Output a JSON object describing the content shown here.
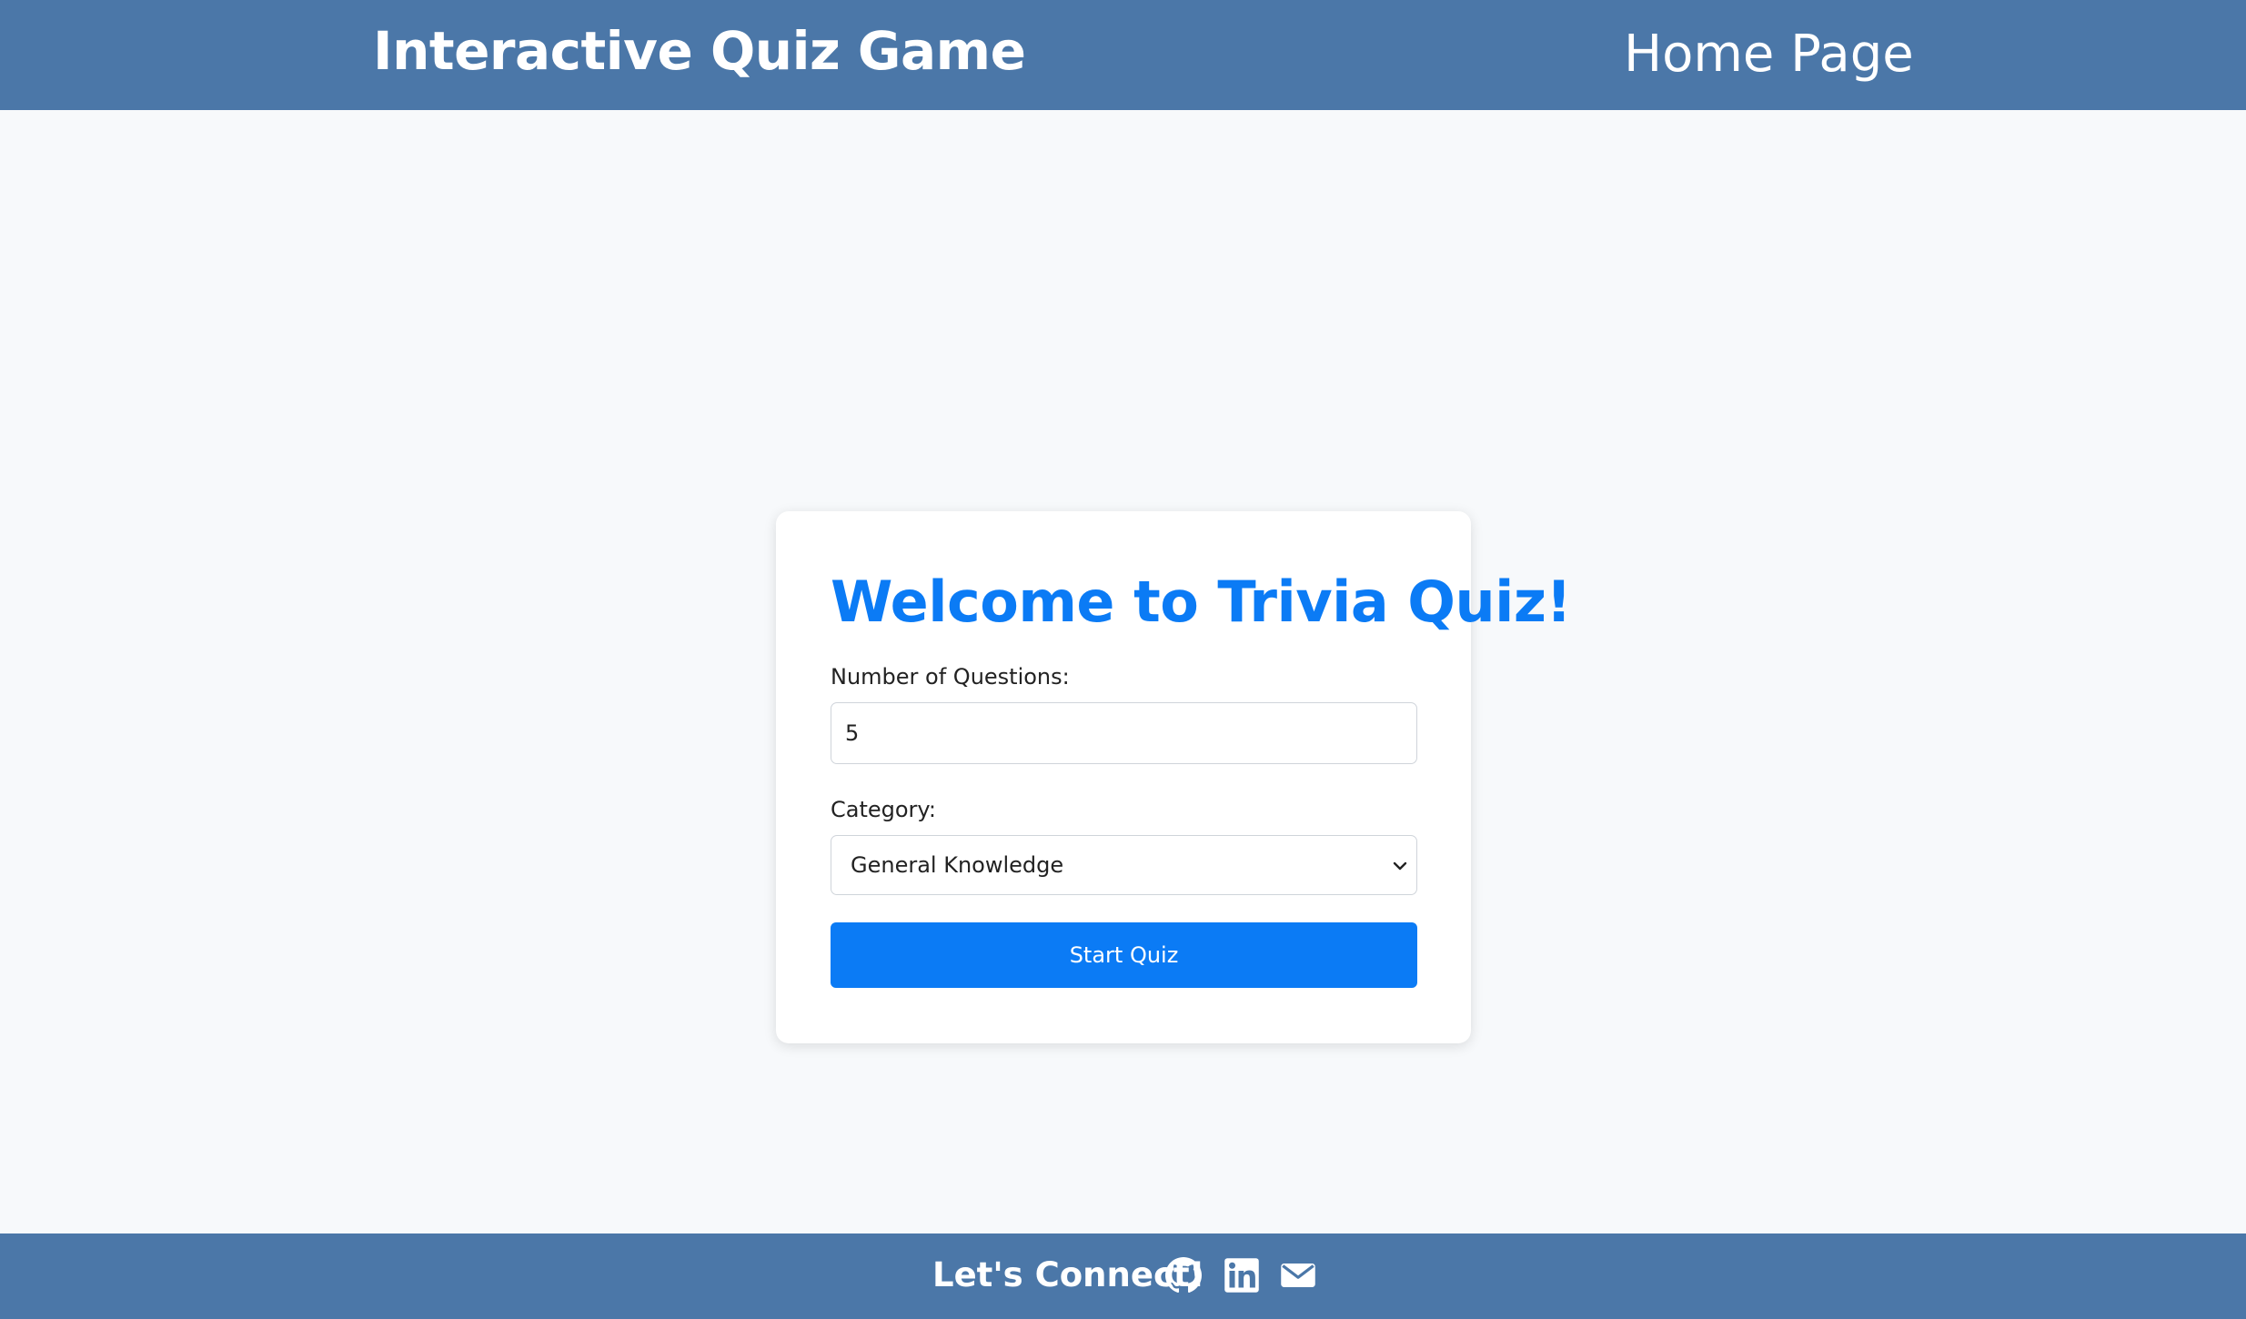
{
  "header": {
    "title": "Interactive Quiz Game",
    "nav_link": "Home Page"
  },
  "card": {
    "title": "Welcome to Trivia Quiz!",
    "questions_label": "Number of Questions:",
    "questions_value": "5",
    "category_label": "Category:",
    "category_selected": "General Knowledge",
    "start_button": "Start Quiz"
  },
  "footer": {
    "text": "Let's Connect!",
    "icons": [
      "github-icon",
      "linkedin-icon",
      "mail-icon"
    ]
  },
  "colors": {
    "header_bg": "#4b77a8",
    "accent": "#0b7bf5",
    "page_bg": "#f7f9fb"
  }
}
